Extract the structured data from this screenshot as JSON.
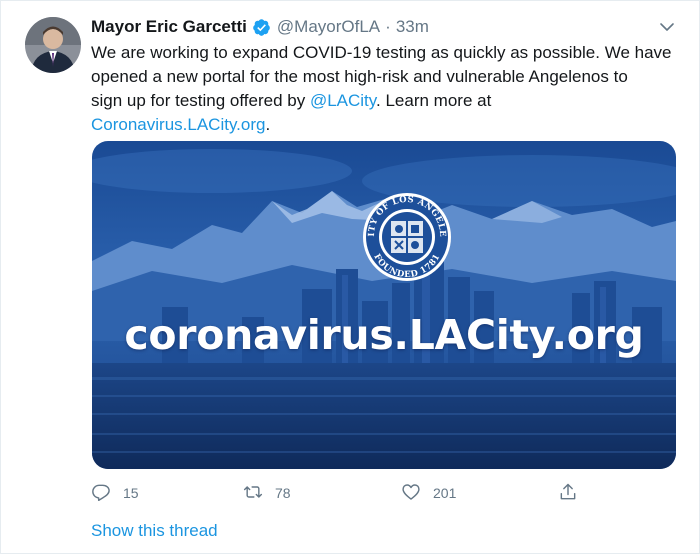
{
  "tweet": {
    "author_name": "Mayor Eric Garcetti",
    "handle": "@MayorOfLA",
    "separator": "·",
    "time": "33m",
    "text_lines": [
      "We are working to expand COVID-19 testing as quickly as possible. We have",
      "opened a new portal for the most high-risk and vulnerable Angelenos to"
    ],
    "text_line3_prefix": "sign up for testing offered by ",
    "mention": "@LACity",
    "text_line3_suffix": ". Learn more at",
    "link": "Coronavirus.LACity.org",
    "link_suffix": "."
  },
  "media": {
    "banner_text": "coronavirus.LACity.org",
    "seal_top_text": "CITY OF LOS ANGELES",
    "seal_bottom_text": "FOUNDED 1781"
  },
  "actions": {
    "reply_count": "15",
    "retweet_count": "78",
    "like_count": "201"
  },
  "show_thread": "Show this thread",
  "icons": {
    "verified": "verified-badge-icon",
    "caret": "chevron-down-icon",
    "reply": "reply-icon",
    "retweet": "retweet-icon",
    "like": "heart-icon",
    "share": "share-icon"
  },
  "colors": {
    "link": "#1b95e0",
    "muted": "#657786",
    "text": "#14171a",
    "banner_blue": "#1d4f9a"
  }
}
